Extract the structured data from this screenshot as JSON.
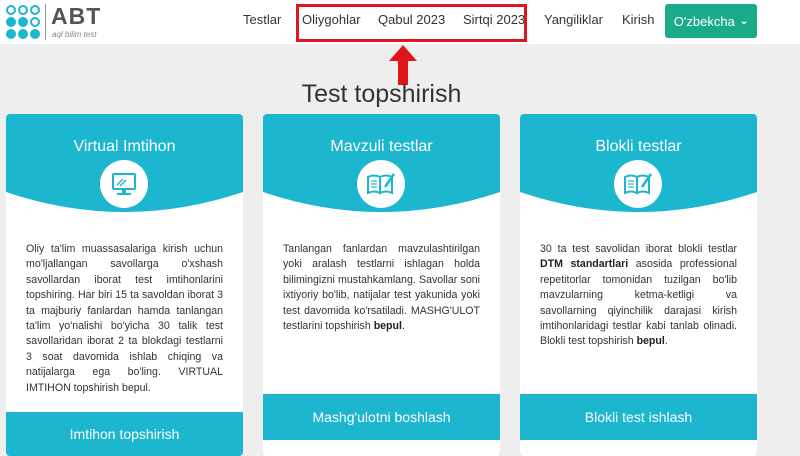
{
  "logo": {
    "title": "ABT",
    "subtitle": "aql bilim test"
  },
  "nav": {
    "items": [
      "Testlar",
      "Oliygohlar",
      "Qabul 2023",
      "Sirtqi 2023",
      "Yangiliklar",
      "Kirish"
    ],
    "language": "O'zbekcha"
  },
  "page_title": "Test topshirish",
  "cards": [
    {
      "title": "Virtual Imtihon",
      "icon": "monitor-icon",
      "text": "Oliy ta'lim muassasalariga kirish uchun mo'ljallangan savollarga o'xshash savollardan iborat test imtihonlarini topshiring. Har biri 15 ta savoldan iborat 3 ta majburiy fanlardan hamda tanlangan ta'lim yo'nalishi bo'yicha 30 talik test savollaridan iborat 2 ta blokdagi testlarni 3 soat davomida ishlab chiqing va natijalarga ega bo'ling. VIRTUAL IMTIHON topshirish bepul.",
      "button": "Imtihon topshirish"
    },
    {
      "title": "Mavzuli testlar",
      "icon": "book-pen-icon",
      "text_before": "Tanlangan fanlardan mavzulashtirilgan yoki aralash testlarni ishlagan holda bilimingizni mustahkamlang. Savollar soni ixtiyoriy bo'lib, natijalar test yakunida yoki test davomida ko'rsatiladi. MASHG'ULOT testlarini topshirish ",
      "text_bold": "bepul",
      "text_after": ".",
      "button": "Mashg'ulotni boshlash"
    },
    {
      "title": "Blokli testlar",
      "icon": "book-pen-icon",
      "text_a": "30 ta test savolidan iborat blokli testlar ",
      "text_a_bold": "DTM standartlari",
      "text_b": " asosida professional repetitorlar tomonidan tuzilgan bo'lib mavzularning ketma-ketligi va savollarning qiyinchilik darajasi kirish imtihonlaridagi testlar kabi tanlab olinadi. Blokli test topshirish ",
      "text_b_bold": "bepul",
      "text_c": ".",
      "button": "Blokli test ishlash"
    }
  ],
  "colors": {
    "primary": "#1cb6cf",
    "language_button": "#1aab8a",
    "highlight": "#e0141b"
  }
}
